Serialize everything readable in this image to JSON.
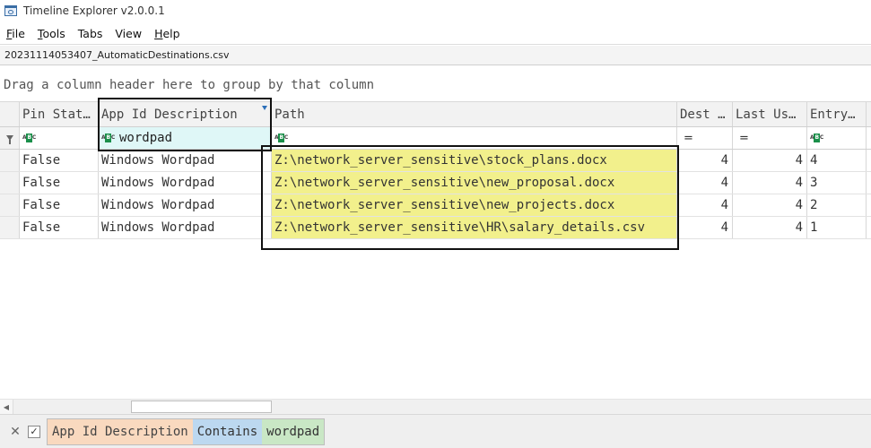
{
  "window": {
    "title": "Timeline Explorer v2.0.0.1"
  },
  "menu": {
    "items": [
      {
        "label": "File",
        "underline": "F",
        "rest": "ile"
      },
      {
        "label": "Tools",
        "underline": "T",
        "rest": "ools"
      },
      {
        "label": "Tabs",
        "underline": "",
        "rest": "Tabs"
      },
      {
        "label": "View",
        "underline": "",
        "rest": "View"
      },
      {
        "label": "Help",
        "underline": "H",
        "rest": "elp"
      }
    ]
  },
  "file_tab": {
    "name": "20231114053407_AutomaticDestinations.csv"
  },
  "group_panel": {
    "hint": "Drag a column header here to group by that column"
  },
  "columns": [
    {
      "key": "pin_status",
      "label": "Pin Stat…"
    },
    {
      "key": "app_id_description",
      "label": "App Id Description"
    },
    {
      "key": "path",
      "label": "Path"
    },
    {
      "key": "dest",
      "label": "Dest …"
    },
    {
      "key": "last_used",
      "label": "Last Us…"
    },
    {
      "key": "entry",
      "label": "Entry…"
    }
  ],
  "filter_row": {
    "app_id_description": "wordpad",
    "dest_op": "=",
    "last_used_op": "="
  },
  "rows": [
    {
      "pin_status": "False",
      "app_id_description": "Windows Wordpad",
      "path": "Z:\\network_server_sensitive\\stock_plans.docx",
      "dest": "4",
      "last_used": "4",
      "entry": "4"
    },
    {
      "pin_status": "False",
      "app_id_description": "Windows Wordpad",
      "path": "Z:\\network_server_sensitive\\new_proposal.docx",
      "dest": "4",
      "last_used": "4",
      "entry": "3"
    },
    {
      "pin_status": "False",
      "app_id_description": "Windows Wordpad",
      "path": "Z:\\network_server_sensitive\\new_projects.docx",
      "dest": "4",
      "last_used": "4",
      "entry": "2"
    },
    {
      "pin_status": "False",
      "app_id_description": "Windows Wordpad",
      "path": "Z:\\network_server_sensitive\\HR\\salary_details.csv",
      "dest": "4",
      "last_used": "4",
      "entry": "1"
    }
  ],
  "active_filter": {
    "field": "App Id Description",
    "operator": "Contains",
    "value": "wordpad"
  },
  "colors": {
    "highlight_path": "#f2f08c",
    "filter_cell": "#dff7f7",
    "field_token": "#f9d9bf",
    "operator_token": "#bcd8f0",
    "value_token": "#c9e7c5"
  }
}
